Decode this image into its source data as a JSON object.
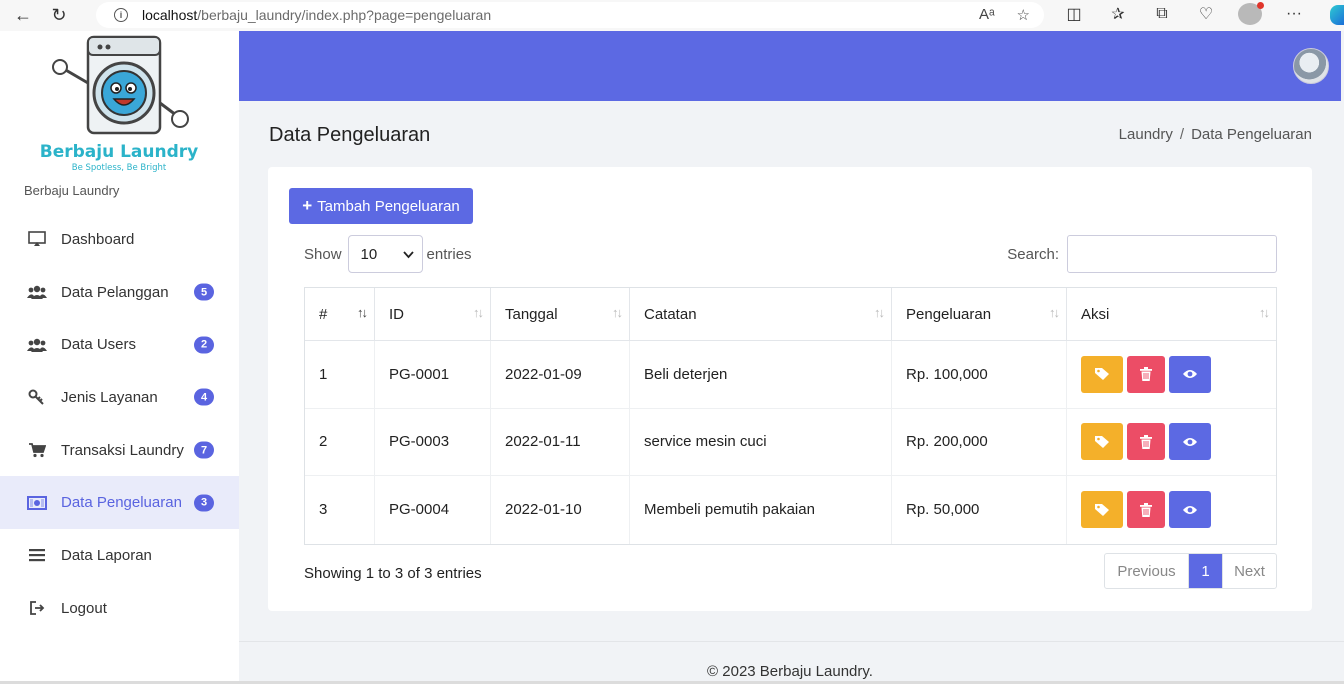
{
  "browser": {
    "url_host": "localhost",
    "url_path": "/berbaju_laundry/index.php?page=pengeluaran"
  },
  "sidebar": {
    "logo_title": "Berbaju Laundry",
    "logo_tagline": "Be Spotless, Be Bright",
    "brand_name": "Berbaju Laundry",
    "items": [
      {
        "label": "Dashboard",
        "icon": "monitor-icon",
        "badge": null
      },
      {
        "label": "Data Pelanggan",
        "icon": "users-icon",
        "badge": "5"
      },
      {
        "label": "Data Users",
        "icon": "users-icon",
        "badge": "2"
      },
      {
        "label": "Jenis Layanan",
        "icon": "key-icon",
        "badge": "4"
      },
      {
        "label": "Transaksi Laundry",
        "icon": "cart-icon",
        "badge": "7"
      },
      {
        "label": "Data Pengeluaran",
        "icon": "money-icon",
        "badge": "3",
        "active": true
      },
      {
        "label": "Data Laporan",
        "icon": "menu-lines-icon",
        "badge": null
      },
      {
        "label": "Logout",
        "icon": "logout-icon",
        "badge": null
      }
    ]
  },
  "page": {
    "title": "Data Pengeluaran",
    "breadcrumb": [
      "Laundry",
      "Data Pengeluaran"
    ],
    "breadcrumb_sep": "/"
  },
  "toolbar": {
    "add_label": "Tambah Pengeluaran",
    "show_label": "Show",
    "entries_value": "10",
    "entries_label": "entries",
    "search_label": "Search:"
  },
  "table": {
    "columns": [
      "#",
      "ID",
      "Tanggal",
      "Catatan",
      "Pengeluaran",
      "Aksi"
    ],
    "rows": [
      {
        "no": "1",
        "id": "PG-0001",
        "tanggal": "2022-01-09",
        "catatan": "Beli deterjen",
        "pengeluaran": "Rp. 100,000"
      },
      {
        "no": "2",
        "id": "PG-0003",
        "tanggal": "2022-01-11",
        "catatan": "service mesin cuci",
        "pengeluaran": "Rp. 200,000"
      },
      {
        "no": "3",
        "id": "PG-0004",
        "tanggal": "2022-01-10",
        "catatan": "Membeli pemutih pakaian",
        "pengeluaran": "Rp. 50,000"
      }
    ]
  },
  "pagination": {
    "info": "Showing 1 to 3 of 3 entries",
    "previous": "Previous",
    "current": "1",
    "next": "Next"
  },
  "footer": {
    "text": "© 2023 Berbaju Laundry."
  },
  "colors": {
    "primary": "#5c69e3",
    "warning": "#f4b02a",
    "danger": "#ec4d66"
  }
}
